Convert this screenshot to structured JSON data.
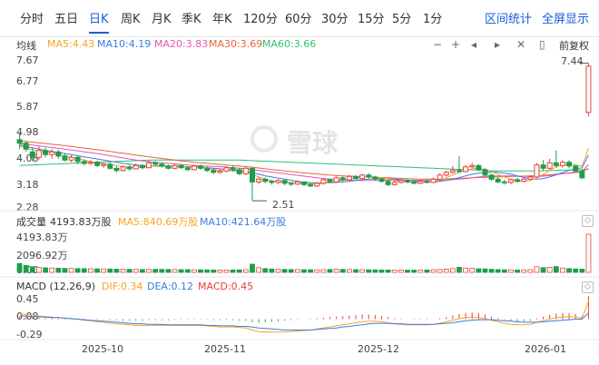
{
  "tabs": {
    "items": [
      "分时",
      "五日",
      "日K",
      "周K",
      "月K",
      "季K",
      "年K",
      "120分",
      "60分",
      "30分",
      "15分",
      "5分",
      "1分"
    ],
    "active": "日K",
    "stats": "区间统计",
    "fullscreen": "全屏显示"
  },
  "ma": {
    "title": "均线",
    "ma5": "MA5:4.43",
    "ma10": "MA10:4.19",
    "ma20": "MA20:3.83",
    "ma30": "MA30:3.69",
    "ma60": "MA60:3.66",
    "adjust": "前复权",
    "colors": {
      "ma5": "#f5a623",
      "ma10": "#3d7be0",
      "ma20": "#e356b5",
      "ma30": "#e8643c",
      "ma60": "#2fbf71"
    }
  },
  "price_axis": [
    "7.67",
    "6.77",
    "5.87",
    "4.98",
    "4.08",
    "3.18",
    "2.28"
  ],
  "annotations": {
    "high": "7.44",
    "low": "2.51"
  },
  "volume": {
    "title": "成交量",
    "total": "4193.83万股",
    "ma5": "MA5:840.69万股",
    "ma10": "MA10:421.64万股",
    "axis": [
      "4193.83万",
      "2096.92万",
      "0.00"
    ]
  },
  "macd": {
    "title": "MACD (12,26,9)",
    "dif": "DIF:0.34",
    "dea": "DEA:0.12",
    "macd": "MACD:0.45",
    "axis": [
      "0.45",
      "0.08",
      "-0.29"
    ]
  },
  "dates": [
    "2025-10",
    "2025-11",
    "2025-12",
    "2026-01"
  ],
  "watermark": "雪球",
  "chart_data": {
    "type": "candlestick",
    "ylim": [
      2.28,
      7.67
    ],
    "up_color": "#e8413c",
    "down_color": "#1e9e4a",
    "candles": [
      [
        4.75,
        4.62,
        4.98,
        4.4
      ],
      [
        4.62,
        4.4,
        4.7,
        4.3
      ],
      [
        4.3,
        4.1,
        4.45,
        3.95
      ],
      [
        4.1,
        4.35,
        4.5,
        4.0
      ],
      [
        4.35,
        4.2,
        4.45,
        4.1
      ],
      [
        4.2,
        4.3,
        4.4,
        4.05
      ],
      [
        4.3,
        4.15,
        4.38,
        4.05
      ],
      [
        4.15,
        4.0,
        4.25,
        3.95
      ],
      [
        4.0,
        4.1,
        4.18,
        3.92
      ],
      [
        4.1,
        3.95,
        4.15,
        3.85
      ],
      [
        3.95,
        3.88,
        4.02,
        3.8
      ],
      [
        3.88,
        3.92,
        4.0,
        3.82
      ],
      [
        3.92,
        3.8,
        3.98,
        3.75
      ],
      [
        3.8,
        3.85,
        3.9,
        3.72
      ],
      [
        3.85,
        3.7,
        3.92,
        3.65
      ],
      [
        3.7,
        3.62,
        3.78,
        3.55
      ],
      [
        3.62,
        3.75,
        3.8,
        3.58
      ],
      [
        3.75,
        3.68,
        3.82,
        3.6
      ],
      [
        3.68,
        3.8,
        3.88,
        3.65
      ],
      [
        3.8,
        3.72,
        3.85,
        3.66
      ],
      [
        3.72,
        3.9,
        3.98,
        3.7
      ],
      [
        3.9,
        3.85,
        3.96,
        3.78
      ],
      [
        3.85,
        3.78,
        3.92,
        3.72
      ],
      [
        3.78,
        3.7,
        3.84,
        3.65
      ],
      [
        3.7,
        3.8,
        3.85,
        3.66
      ],
      [
        3.8,
        3.72,
        3.86,
        3.68
      ],
      [
        3.72,
        3.65,
        3.78,
        3.6
      ],
      [
        3.65,
        3.78,
        3.82,
        3.62
      ],
      [
        3.78,
        3.7,
        3.84,
        3.64
      ],
      [
        3.7,
        3.62,
        3.76,
        3.56
      ],
      [
        3.62,
        3.55,
        3.7,
        3.48
      ],
      [
        3.55,
        3.6,
        3.66,
        3.5
      ],
      [
        3.6,
        3.72,
        3.78,
        3.55
      ],
      [
        3.72,
        3.65,
        3.8,
        3.58
      ],
      [
        3.65,
        3.5,
        3.7,
        3.45
      ],
      [
        3.5,
        3.7,
        3.75,
        3.45
      ],
      [
        3.7,
        3.2,
        3.72,
        2.51
      ],
      [
        3.2,
        3.3,
        3.38,
        3.12
      ],
      [
        3.3,
        3.22,
        3.36,
        3.15
      ],
      [
        3.22,
        3.18,
        3.28,
        3.1
      ],
      [
        3.18,
        3.25,
        3.3,
        3.12
      ],
      [
        3.25,
        3.15,
        3.28,
        3.08
      ],
      [
        3.15,
        3.12,
        3.2,
        3.05
      ],
      [
        3.12,
        3.2,
        3.24,
        3.08
      ],
      [
        3.2,
        3.1,
        3.22,
        3.05
      ],
      [
        3.1,
        3.05,
        3.16,
        3.0
      ],
      [
        3.05,
        3.15,
        3.2,
        3.02
      ],
      [
        3.15,
        3.28,
        3.34,
        3.1
      ],
      [
        3.28,
        3.2,
        3.32,
        3.15
      ],
      [
        3.2,
        3.35,
        3.4,
        3.18
      ],
      [
        3.35,
        3.28,
        3.42,
        3.22
      ],
      [
        3.28,
        3.4,
        3.46,
        3.25
      ],
      [
        3.4,
        3.32,
        3.45,
        3.28
      ],
      [
        3.32,
        3.45,
        3.5,
        3.3
      ],
      [
        3.45,
        3.38,
        3.52,
        3.32
      ],
      [
        3.38,
        3.3,
        3.42,
        3.25
      ],
      [
        3.3,
        3.22,
        3.35,
        3.18
      ],
      [
        3.22,
        3.1,
        3.28,
        3.05
      ],
      [
        3.1,
        3.18,
        3.24,
        3.06
      ],
      [
        3.18,
        3.25,
        3.3,
        3.14
      ],
      [
        3.25,
        3.2,
        3.3,
        3.15
      ],
      [
        3.2,
        3.15,
        3.26,
        3.1
      ],
      [
        3.15,
        3.22,
        3.28,
        3.12
      ],
      [
        3.22,
        3.18,
        3.3,
        3.14
      ],
      [
        3.18,
        3.3,
        3.36,
        3.15
      ],
      [
        3.3,
        3.45,
        3.52,
        3.25
      ],
      [
        3.45,
        3.55,
        3.62,
        3.4
      ],
      [
        3.55,
        3.62,
        3.78,
        3.5
      ],
      [
        3.62,
        3.58,
        4.15,
        3.52
      ],
      [
        3.58,
        3.75,
        3.82,
        3.55
      ],
      [
        3.75,
        3.8,
        3.9,
        3.7
      ],
      [
        3.8,
        3.65,
        3.85,
        3.6
      ],
      [
        3.65,
        3.45,
        3.7,
        3.4
      ],
      [
        3.45,
        3.3,
        3.5,
        3.25
      ],
      [
        3.3,
        3.2,
        3.38,
        3.15
      ],
      [
        3.2,
        3.18,
        3.28,
        3.1
      ],
      [
        3.18,
        3.28,
        3.32,
        3.12
      ],
      [
        3.28,
        3.22,
        3.35,
        3.18
      ],
      [
        3.22,
        3.3,
        3.36,
        3.18
      ],
      [
        3.3,
        3.38,
        3.45,
        3.25
      ],
      [
        3.38,
        3.82,
        3.9,
        3.35
      ],
      [
        3.82,
        3.7,
        4.0,
        3.6
      ],
      [
        3.7,
        3.9,
        4.05,
        3.65
      ],
      [
        3.9,
        3.8,
        4.35,
        3.72
      ],
      [
        3.8,
        3.92,
        4.0,
        3.72
      ],
      [
        3.92,
        3.78,
        4.0,
        3.7
      ],
      [
        3.78,
        3.6,
        3.82,
        3.55
      ],
      [
        3.6,
        3.35,
        3.65,
        3.3
      ],
      [
        5.75,
        7.44,
        7.55,
        5.6
      ]
    ],
    "ma5": [
      4.5,
      4.45,
      4.38,
      4.32,
      4.3,
      4.25,
      4.2,
      4.15,
      4.1,
      4.05,
      4.0,
      3.95,
      3.9,
      3.87,
      3.84,
      3.8,
      3.76,
      3.74,
      3.73,
      3.75,
      3.77,
      3.8,
      3.8,
      3.79,
      3.78,
      3.76,
      3.75,
      3.74,
      3.73,
      3.7,
      3.66,
      3.62,
      3.61,
      3.6,
      3.58,
      3.55,
      3.48,
      3.38,
      3.3,
      3.24,
      3.22,
      3.2,
      3.18,
      3.17,
      3.15,
      3.13,
      3.12,
      3.15,
      3.18,
      3.22,
      3.26,
      3.3,
      3.34,
      3.37,
      3.4,
      3.38,
      3.35,
      3.3,
      3.24,
      3.21,
      3.19,
      3.18,
      3.18,
      3.2,
      3.22,
      3.27,
      3.35,
      3.45,
      3.55,
      3.62,
      3.68,
      3.7,
      3.66,
      3.58,
      3.48,
      3.38,
      3.3,
      3.24,
      3.22,
      3.25,
      3.35,
      3.48,
      3.62,
      3.75,
      3.82,
      3.85,
      3.82,
      3.78,
      4.43
    ],
    "ma10": [
      4.55,
      4.5,
      4.45,
      4.4,
      4.36,
      4.32,
      4.28,
      4.24,
      4.2,
      4.16,
      4.12,
      4.08,
      4.04,
      4.0,
      3.96,
      3.92,
      3.88,
      3.85,
      3.82,
      3.8,
      3.78,
      3.78,
      3.78,
      3.77,
      3.76,
      3.76,
      3.76,
      3.75,
      3.74,
      3.72,
      3.7,
      3.68,
      3.66,
      3.64,
      3.61,
      3.58,
      3.54,
      3.48,
      3.42,
      3.38,
      3.34,
      3.3,
      3.26,
      3.22,
      3.19,
      3.17,
      3.16,
      3.16,
      3.17,
      3.18,
      3.2,
      3.22,
      3.25,
      3.28,
      3.3,
      3.32,
      3.32,
      3.31,
      3.3,
      3.28,
      3.26,
      3.24,
      3.22,
      3.2,
      3.2,
      3.22,
      3.25,
      3.3,
      3.36,
      3.42,
      3.48,
      3.52,
      3.55,
      3.56,
      3.55,
      3.52,
      3.48,
      3.42,
      3.36,
      3.32,
      3.3,
      3.32,
      3.38,
      3.46,
      3.54,
      3.62,
      3.68,
      3.72,
      4.19
    ],
    "ma20": [
      4.6,
      4.58,
      4.55,
      4.52,
      4.49,
      4.46,
      4.43,
      4.4,
      4.37,
      4.34,
      4.3,
      4.27,
      4.24,
      4.2,
      4.16,
      4.12,
      4.08,
      4.04,
      4.0,
      3.97,
      3.94,
      3.92,
      3.9,
      3.88,
      3.86,
      3.84,
      3.82,
      3.8,
      3.79,
      3.78,
      3.77,
      3.76,
      3.74,
      3.72,
      3.7,
      3.68,
      3.65,
      3.62,
      3.59,
      3.56,
      3.53,
      3.5,
      3.47,
      3.44,
      3.41,
      3.38,
      3.35,
      3.32,
      3.3,
      3.28,
      3.27,
      3.26,
      3.25,
      3.25,
      3.25,
      3.25,
      3.26,
      3.26,
      3.26,
      3.26,
      3.26,
      3.26,
      3.26,
      3.25,
      3.25,
      3.25,
      3.26,
      3.28,
      3.3,
      3.32,
      3.35,
      3.38,
      3.4,
      3.41,
      3.42,
      3.42,
      3.42,
      3.41,
      3.4,
      3.4,
      3.4,
      3.41,
      3.43,
      3.46,
      3.5,
      3.53,
      3.56,
      3.58,
      3.83
    ],
    "ma30": [
      4.7,
      4.68,
      4.66,
      4.63,
      4.61,
      4.58,
      4.56,
      4.53,
      4.5,
      4.47,
      4.44,
      4.41,
      4.38,
      4.35,
      4.32,
      4.28,
      4.25,
      4.22,
      4.18,
      4.15,
      4.12,
      4.09,
      4.06,
      4.03,
      4.0,
      3.97,
      3.95,
      3.92,
      3.9,
      3.88,
      3.86,
      3.84,
      3.82,
      3.8,
      3.78,
      3.76,
      3.74,
      3.71,
      3.68,
      3.65,
      3.63,
      3.6,
      3.58,
      3.55,
      3.53,
      3.51,
      3.49,
      3.47,
      3.45,
      3.43,
      3.42,
      3.41,
      3.4,
      3.39,
      3.38,
      3.37,
      3.36,
      3.35,
      3.34,
      3.33,
      3.32,
      3.31,
      3.3,
      3.3,
      3.3,
      3.3,
      3.31,
      3.32,
      3.33,
      3.34,
      3.35,
      3.36,
      3.37,
      3.38,
      3.38,
      3.39,
      3.4,
      3.4,
      3.41,
      3.42,
      3.43,
      3.44,
      3.46,
      3.48,
      3.5,
      3.52,
      3.54,
      3.56,
      3.69
    ],
    "ma60": [
      3.8,
      3.81,
      3.82,
      3.83,
      3.84,
      3.85,
      3.86,
      3.87,
      3.88,
      3.89,
      3.9,
      3.91,
      3.92,
      3.93,
      3.94,
      3.95,
      3.96,
      3.97,
      3.98,
      3.99,
      4.0,
      4.0,
      4.0,
      4.0,
      4.0,
      4.0,
      4.0,
      4.0,
      4.0,
      4.0,
      4.0,
      4.0,
      4.0,
      4.0,
      4.0,
      3.99,
      3.98,
      3.97,
      3.96,
      3.95,
      3.94,
      3.93,
      3.92,
      3.91,
      3.9,
      3.89,
      3.88,
      3.87,
      3.86,
      3.85,
      3.84,
      3.83,
      3.82,
      3.81,
      3.8,
      3.79,
      3.78,
      3.77,
      3.76,
      3.75,
      3.74,
      3.73,
      3.72,
      3.71,
      3.7,
      3.69,
      3.68,
      3.67,
      3.66,
      3.65,
      3.64,
      3.63,
      3.62,
      3.61,
      3.6,
      3.6,
      3.6,
      3.6,
      3.6,
      3.6,
      3.6,
      3.61,
      3.62,
      3.62,
      3.63,
      3.63,
      3.64,
      3.65,
      3.66
    ],
    "volumes": [
      980,
      760,
      620,
      540,
      500,
      480,
      460,
      440,
      430,
      420,
      410,
      400,
      390,
      380,
      370,
      360,
      350,
      340,
      330,
      320,
      330,
      340,
      330,
      320,
      310,
      300,
      300,
      290,
      290,
      280,
      270,
      260,
      260,
      270,
      280,
      300,
      900,
      520,
      420,
      380,
      350,
      330,
      320,
      310,
      300,
      290,
      280,
      300,
      320,
      340,
      330,
      320,
      310,
      300,
      290,
      280,
      270,
      260,
      250,
      250,
      250,
      250,
      260,
      270,
      290,
      320,
      360,
      420,
      560,
      480,
      440,
      400,
      380,
      340,
      310,
      290,
      280,
      270,
      280,
      300,
      620,
      520,
      560,
      640,
      480,
      420,
      380,
      360,
      4193.83
    ],
    "macd_bars": [
      0.05,
      0.04,
      0.04,
      0.03,
      0.03,
      0.03,
      0.02,
      0.02,
      0.02,
      0.01,
      0.01,
      0.0,
      -0.01,
      -0.01,
      -0.02,
      -0.02,
      -0.03,
      -0.03,
      -0.03,
      -0.03,
      -0.02,
      -0.02,
      -0.02,
      -0.02,
      -0.01,
      -0.01,
      -0.01,
      -0.01,
      -0.01,
      -0.01,
      -0.02,
      -0.02,
      -0.02,
      -0.02,
      -0.03,
      -0.03,
      -0.06,
      -0.07,
      -0.06,
      -0.05,
      -0.04,
      -0.03,
      -0.02,
      -0.01,
      0.0,
      0.01,
      0.02,
      0.03,
      0.04,
      0.05,
      0.06,
      0.07,
      0.08,
      0.09,
      0.09,
      0.08,
      0.06,
      0.04,
      0.02,
      0.01,
      0.0,
      -0.01,
      -0.01,
      -0.01,
      0.0,
      0.02,
      0.04,
      0.07,
      0.1,
      0.12,
      0.13,
      0.12,
      0.09,
      0.05,
      0.02,
      -0.01,
      -0.03,
      -0.04,
      -0.04,
      -0.03,
      0.02,
      0.05,
      0.08,
      0.11,
      0.12,
      0.12,
      0.1,
      0.07,
      0.45
    ],
    "dif": [
      0.1,
      0.09,
      0.08,
      0.06,
      0.05,
      0.04,
      0.03,
      0.02,
      0.01,
      0.0,
      -0.02,
      -0.03,
      -0.05,
      -0.06,
      -0.08,
      -0.09,
      -0.1,
      -0.11,
      -0.12,
      -0.12,
      -0.12,
      -0.12,
      -0.12,
      -0.12,
      -0.12,
      -0.12,
      -0.12,
      -0.12,
      -0.12,
      -0.13,
      -0.14,
      -0.15,
      -0.15,
      -0.15,
      -0.16,
      -0.17,
      -0.21,
      -0.24,
      -0.25,
      -0.25,
      -0.25,
      -0.25,
      -0.24,
      -0.23,
      -0.22,
      -0.21,
      -0.19,
      -0.17,
      -0.15,
      -0.13,
      -0.11,
      -0.09,
      -0.07,
      -0.05,
      -0.04,
      -0.04,
      -0.05,
      -0.07,
      -0.09,
      -0.1,
      -0.11,
      -0.11,
      -0.11,
      -0.11,
      -0.1,
      -0.08,
      -0.05,
      -0.02,
      0.01,
      0.03,
      0.04,
      0.03,
      0.01,
      -0.02,
      -0.05,
      -0.08,
      -0.1,
      -0.11,
      -0.11,
      -0.1,
      -0.06,
      -0.03,
      0.0,
      0.03,
      0.04,
      0.05,
      0.04,
      0.02,
      0.34
    ],
    "dea": [
      0.06,
      0.06,
      0.05,
      0.05,
      0.04,
      0.03,
      0.03,
      0.02,
      0.01,
      0.0,
      -0.01,
      -0.02,
      -0.03,
      -0.04,
      -0.05,
      -0.06,
      -0.07,
      -0.08,
      -0.09,
      -0.09,
      -0.1,
      -0.1,
      -0.1,
      -0.11,
      -0.11,
      -0.11,
      -0.11,
      -0.11,
      -0.11,
      -0.12,
      -0.12,
      -0.13,
      -0.13,
      -0.13,
      -0.14,
      -0.14,
      -0.15,
      -0.17,
      -0.18,
      -0.19,
      -0.2,
      -0.21,
      -0.21,
      -0.21,
      -0.21,
      -0.21,
      -0.2,
      -0.19,
      -0.18,
      -0.17,
      -0.15,
      -0.14,
      -0.12,
      -0.11,
      -0.09,
      -0.08,
      -0.08,
      -0.08,
      -0.09,
      -0.09,
      -0.1,
      -0.1,
      -0.1,
      -0.1,
      -0.1,
      -0.09,
      -0.08,
      -0.07,
      -0.05,
      -0.03,
      -0.02,
      -0.01,
      -0.01,
      -0.01,
      -0.02,
      -0.03,
      -0.04,
      -0.05,
      -0.06,
      -0.06,
      -0.06,
      -0.05,
      -0.04,
      -0.03,
      -0.02,
      -0.01,
      0.0,
      0.0,
      0.12
    ],
    "macd_ylim": [
      -0.29,
      0.45
    ],
    "volume_ylim": [
      0,
      4193.83
    ]
  }
}
